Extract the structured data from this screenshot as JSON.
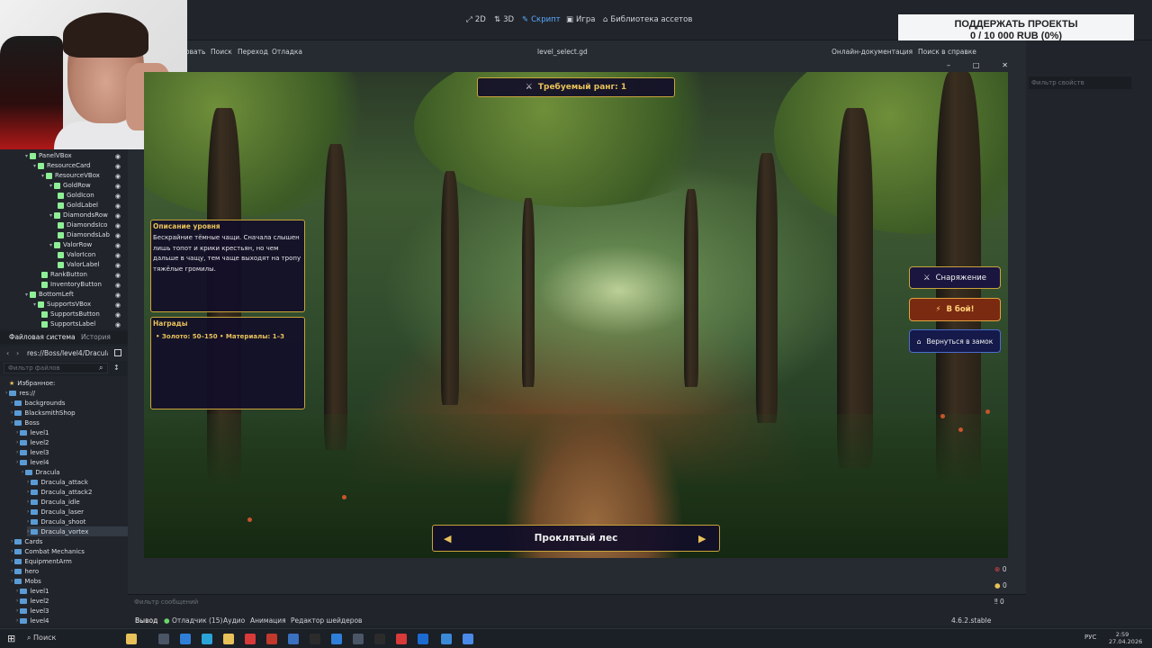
{
  "topbar": {
    "tabs": [
      {
        "label": "2D",
        "icon": "2d-icon"
      },
      {
        "label": "3D",
        "icon": "3d-icon"
      },
      {
        "label": "Скрипт",
        "icon": "script-icon",
        "active": true
      },
      {
        "label": "Игра",
        "icon": "game-icon"
      },
      {
        "label": "Библиотека ассетов",
        "icon": "asset-library-icon"
      }
    ],
    "support_line1": "ПОДДЕРЖАТЬ ПРОЕКТЫ",
    "support_line2": "0 / 10 000 RUB (0%)"
  },
  "script_menu": {
    "items": [
      "овать",
      "Поиск",
      "Переход",
      "Отладка"
    ],
    "file_title": "level_select.gd",
    "online_docs": "Онлайн-документация",
    "help_search": "Поиск в справке"
  },
  "scene_tree": [
    {
      "label": "PanelVBox",
      "indent": 0,
      "arrow": true
    },
    {
      "label": "ResourceCard",
      "indent": 1,
      "arrow": true
    },
    {
      "label": "ResourceVBox",
      "indent": 2,
      "arrow": true
    },
    {
      "label": "GoldRow",
      "indent": 3,
      "arrow": true
    },
    {
      "label": "GoldIcon",
      "indent": 4,
      "arrow": false
    },
    {
      "label": "GoldLabel",
      "indent": 4,
      "arrow": false
    },
    {
      "label": "DiamondsRow",
      "indent": 3,
      "arrow": true
    },
    {
      "label": "DiamondsIco",
      "indent": 4,
      "arrow": false
    },
    {
      "label": "DiamondsLab",
      "indent": 4,
      "arrow": false
    },
    {
      "label": "ValorRow",
      "indent": 3,
      "arrow": true
    },
    {
      "label": "ValorIcon",
      "indent": 4,
      "arrow": false
    },
    {
      "label": "ValorLabel",
      "indent": 4,
      "arrow": false
    },
    {
      "label": "RankButton",
      "indent": 2,
      "arrow": false
    },
    {
      "label": "InventoryButton",
      "indent": 2,
      "arrow": false
    },
    {
      "label": "BottomLeft",
      "indent": 0,
      "arrow": true
    },
    {
      "label": "SupportsVBox",
      "indent": 1,
      "arrow": true
    },
    {
      "label": "SupportsButton",
      "indent": 2,
      "arrow": false
    },
    {
      "label": "SupportsLabel",
      "indent": 2,
      "arrow": false
    }
  ],
  "filesystem": {
    "tab_fs": "Файловая система",
    "tab_history": "История",
    "path": "res://Boss/level4/Dracula/",
    "filter_placeholder": "Фильтр файлов",
    "favorites": "Избранное:",
    "items": [
      {
        "label": "res://",
        "indent": 0
      },
      {
        "label": "backgrounds",
        "indent": 1
      },
      {
        "label": "BlacksmithShop",
        "indent": 1
      },
      {
        "label": "Boss",
        "indent": 1
      },
      {
        "label": "level1",
        "indent": 2
      },
      {
        "label": "level2",
        "indent": 2
      },
      {
        "label": "level3",
        "indent": 2
      },
      {
        "label": "level4",
        "indent": 2
      },
      {
        "label": "Dracula",
        "indent": 3
      },
      {
        "label": "Dracula_attack",
        "indent": 4
      },
      {
        "label": "Dracula_attack2",
        "indent": 4
      },
      {
        "label": "Dracula_idle",
        "indent": 4
      },
      {
        "label": "Dracula_laser",
        "indent": 4
      },
      {
        "label": "Dracula_shoot",
        "indent": 4
      },
      {
        "label": "Dracula_vortex",
        "indent": 4,
        "selected": true
      },
      {
        "label": "Cards",
        "indent": 1
      },
      {
        "label": "Combat Mechanics",
        "indent": 1
      },
      {
        "label": "EquipmentArm",
        "indent": 1
      },
      {
        "label": "hero",
        "indent": 1
      },
      {
        "label": "Mobs",
        "indent": 1
      },
      {
        "label": "level1",
        "indent": 2
      },
      {
        "label": "level2",
        "indent": 2
      },
      {
        "label": "level3",
        "indent": 2
      },
      {
        "label": "level4",
        "indent": 2
      }
    ]
  },
  "game": {
    "rank_label": "Требуемый ранг:  1",
    "description_title": "Описание уровня",
    "description_text": "Бескрайние тёмные чащи. Сначала слышен лишь топот и крики крестьян, но чем дальше в чащу, тем чаще выходят на тропу тяжёлые громилы.",
    "rewards_title": "Награды",
    "rewards_text": "• Золото: 50–150  • Материалы: 1–3",
    "equipment_button": "Снаряжение",
    "fight_button": "В бой!",
    "castle_button": "Вернуться в замок",
    "level_name": "Проклятый лес",
    "prev_arrow": "◀",
    "next_arrow": "▶"
  },
  "right_panel": {
    "filter_placeholder": "Фильтр свойств"
  },
  "bottom": {
    "message_filter": "Фильтр сообщений",
    "tabs": [
      "Вывод",
      "Отладчик (15)",
      "Аудио",
      "Анимация",
      "Редактор шейдеров"
    ],
    "version": "4.6.2.stable",
    "counters": [
      "0",
      "0",
      "0"
    ]
  },
  "taskbar": {
    "search": "Поиск",
    "lang": "РУС",
    "time": "2:59",
    "date": "27.04.2026"
  },
  "colors": {
    "accent": "#5aa8ff",
    "gold": "#c9a43a",
    "panel": "#120e28",
    "fight": "#7a2a10"
  }
}
